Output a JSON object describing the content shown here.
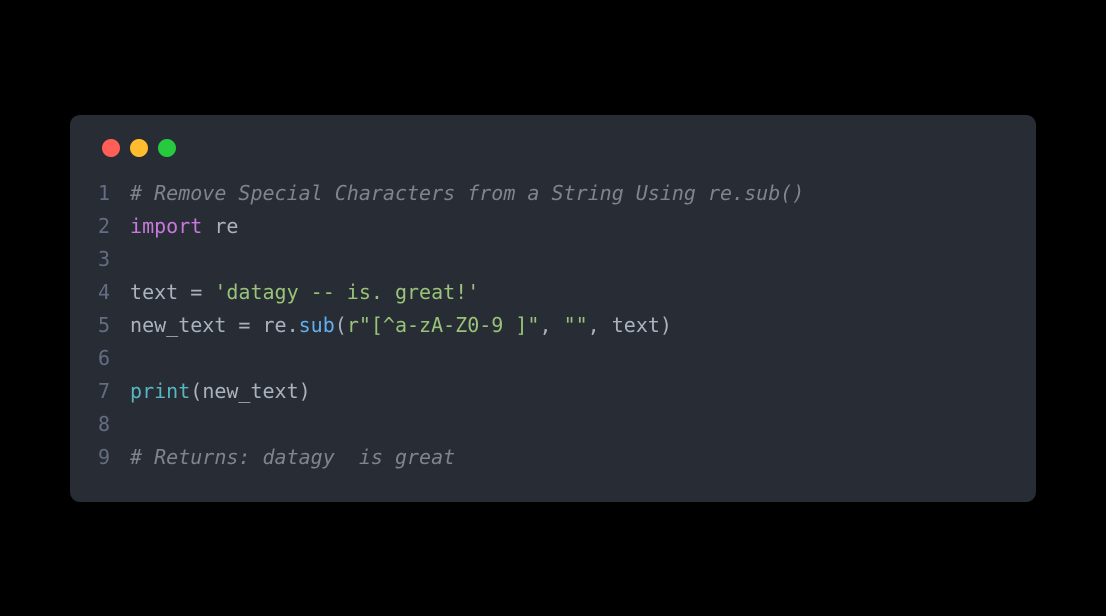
{
  "traffic_lights": {
    "red": "#ff5f56",
    "yellow": "#ffbd2e",
    "green": "#27c93f"
  },
  "line_numbers": [
    "1",
    "2",
    "3",
    "4",
    "5",
    "6",
    "7",
    "8",
    "9"
  ],
  "code": {
    "l1": {
      "comment": "# Remove Special Characters from a String Using re.sub()"
    },
    "l2": {
      "keyword": "import",
      "module": " re"
    },
    "l3": "",
    "l4": {
      "var": "text",
      "eq": " = ",
      "str": "'datagy -- is. great!'"
    },
    "l5": {
      "var": "new_text",
      "eq": " = ",
      "obj": "re",
      "dot": ".",
      "func": "sub",
      "open": "(",
      "arg1": "r\"[^a-zA-Z0-9 ]\"",
      "comma1": ", ",
      "arg2": "\"\"",
      "comma2": ", ",
      "arg3": "text",
      "close": ")"
    },
    "l6": "",
    "l7": {
      "func": "print",
      "open": "(",
      "arg": "new_text",
      "close": ")"
    },
    "l8": "",
    "l9": {
      "comment": "# Returns: datagy  is great"
    }
  }
}
